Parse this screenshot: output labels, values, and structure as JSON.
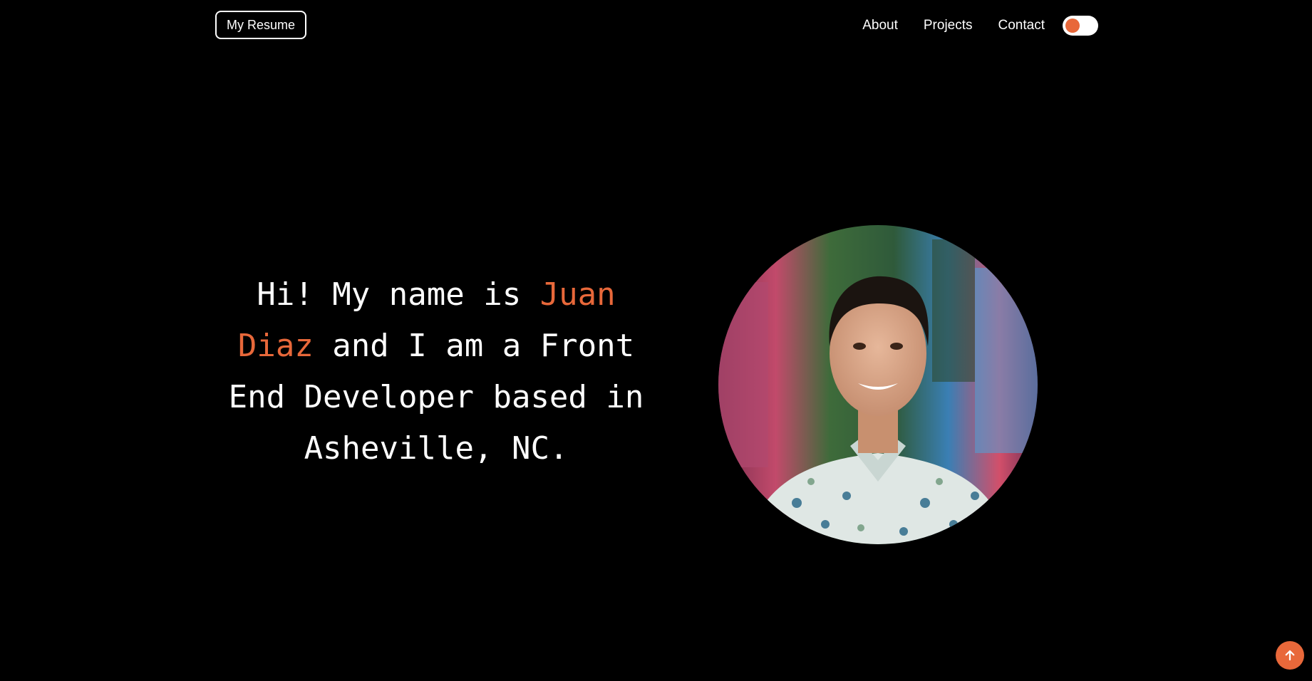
{
  "header": {
    "resume_label": "My Resume",
    "nav": {
      "about": "About",
      "projects": "Projects",
      "contact": "Contact"
    },
    "theme_toggle": {
      "state": "off"
    }
  },
  "hero": {
    "intro_before": "Hi! My name is ",
    "name": "Juan Diaz",
    "intro_after": " and I am a Front End Developer based in Asheville, NC."
  },
  "icons": {
    "scroll_top": "arrow-up-icon",
    "portrait": "profile-photo"
  },
  "colors": {
    "background": "#000000",
    "text": "#ffffff",
    "accent": "#e8683a"
  }
}
